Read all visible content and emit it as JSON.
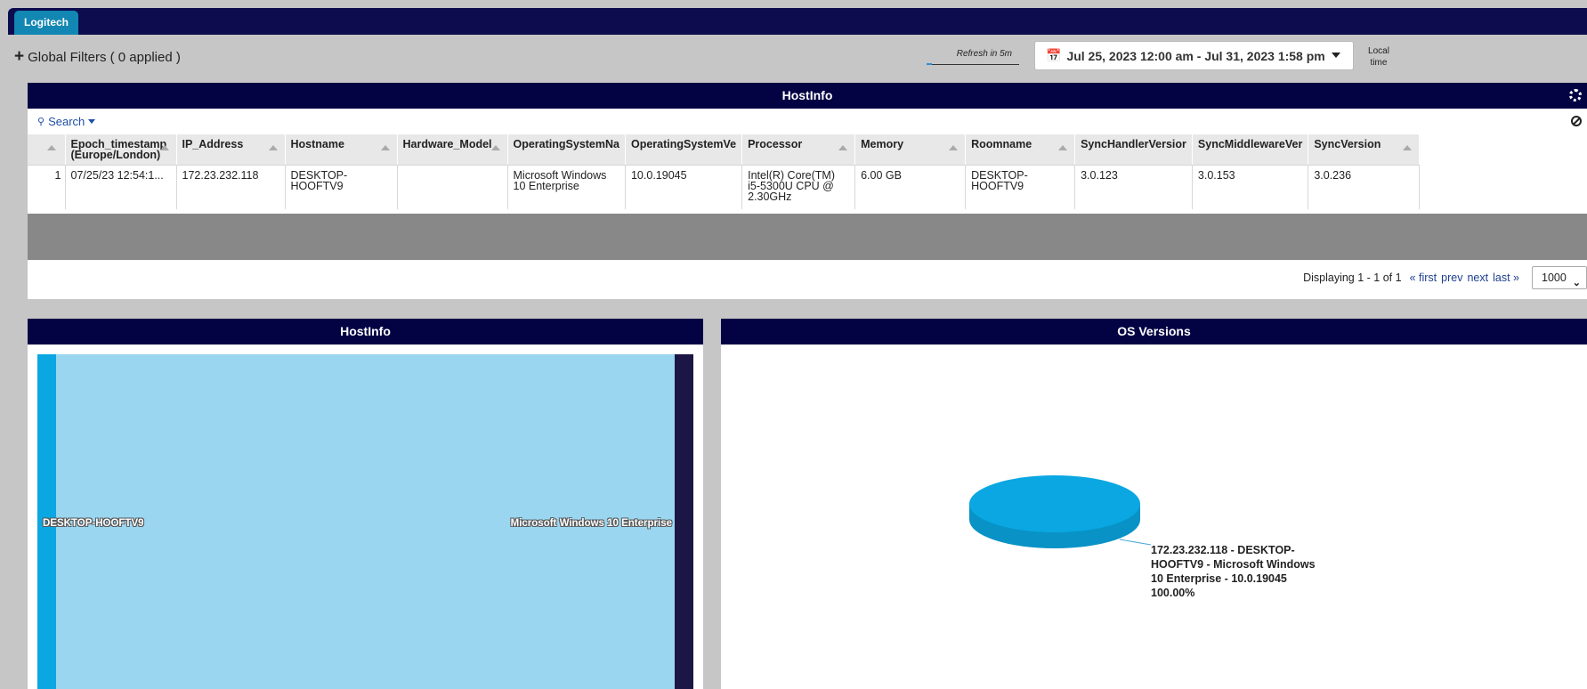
{
  "app": {
    "tab_label": "Logitech"
  },
  "filters": {
    "label": "Global Filters ( 0 applied )",
    "refresh": "Refresh in 5m",
    "date_range": "Jul 25, 2023 12:00 am - Jul 31, 2023 1:58 pm",
    "local_time_1": "Local",
    "local_time_2": "time"
  },
  "grid": {
    "title": "HostInfo",
    "search_label": "Search",
    "columns": [
      "Epoch_timestamp (Europe/London)",
      "IP_Address",
      "Hostname",
      "Hardware_Model",
      "OperatingSystemNa",
      "OperatingSystemVe",
      "Processor",
      "Memory",
      "Roomname",
      "SyncHandlerVersior",
      "SyncMiddlewareVer",
      "SyncVersion"
    ],
    "rows": [
      {
        "index": "1",
        "cells": [
          "07/25/23 12:54:1...",
          "172.23.232.118",
          "DESKTOP-HOOFTV9",
          "",
          "Microsoft Windows 10 Enterprise",
          "10.0.19045",
          "Intel(R) Core(TM) i5-5300U CPU @ 2.30GHz",
          "6.00 GB",
          "DESKTOP-HOOFTV9",
          "3.0.123",
          "3.0.153",
          "3.0.236"
        ]
      }
    ],
    "pager": {
      "displaying": "Displaying 1 - 1 of 1",
      "first": "« first",
      "prev": "prev",
      "next": "next",
      "last": "last »",
      "page_size": "1000"
    }
  },
  "sankey": {
    "title": "HostInfo",
    "source": "DESKTOP-HOOFTV9",
    "target": "Microsoft Windows 10 Enterprise",
    "colors": {
      "source": "#0aa7e2",
      "band": "#9ad6f0",
      "target": "#1c1645"
    }
  },
  "pie": {
    "title": "OS Versions",
    "label_lines": [
      "172.23.232.118 - DESKTOP-",
      "HOOFTV9 - Microsoft Windows",
      "10 Enterprise - 10.0.19045",
      "100.00%"
    ],
    "color": "#0aa7e2"
  },
  "chart_data": {
    "type": "pie",
    "categories": [
      "172.23.232.118 - DESKTOP-HOOFTV9 - Microsoft Windows 10 Enterprise - 10.0.19045"
    ],
    "values": [
      100
    ],
    "title": "OS Versions"
  },
  "colors": {
    "header": "#030344",
    "topbar": "#0c0c4f",
    "accent": "#1287b3"
  }
}
